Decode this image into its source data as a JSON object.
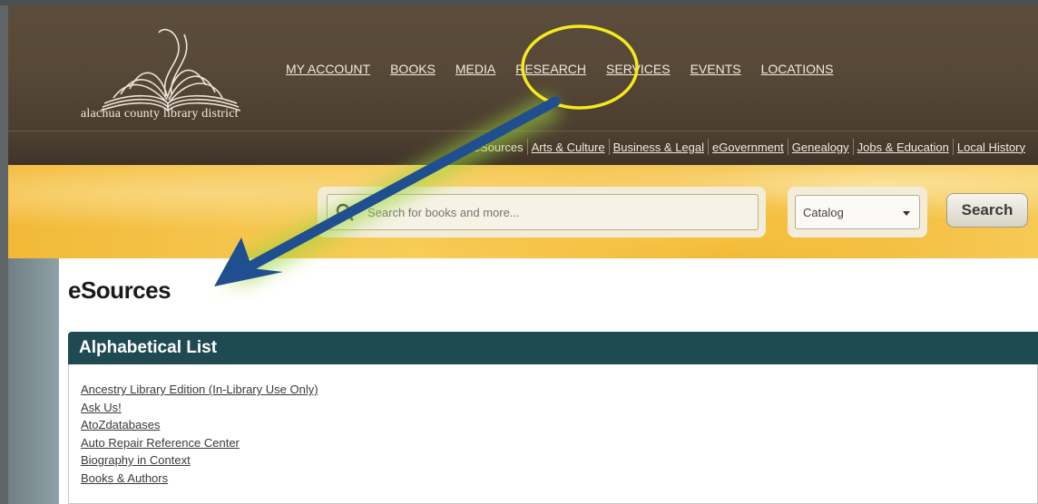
{
  "brand": {
    "logo_text": "alachua county library district"
  },
  "main_nav": [
    {
      "label": "MY ACCOUNT"
    },
    {
      "label": "BOOKS"
    },
    {
      "label": "MEDIA"
    },
    {
      "label": "RESEARCH"
    },
    {
      "label": "SERVICES"
    },
    {
      "label": "EVENTS"
    },
    {
      "label": "LOCATIONS"
    }
  ],
  "sub_nav": [
    {
      "label": "eSources"
    },
    {
      "label": "Arts & Culture"
    },
    {
      "label": "Business & Legal"
    },
    {
      "label": "eGovernment"
    },
    {
      "label": "Genealogy"
    },
    {
      "label": "Jobs & Education"
    },
    {
      "label": "Local History"
    }
  ],
  "search": {
    "placeholder": "Search for books and more...",
    "scope": "Catalog",
    "button_label": "Search"
  },
  "page": {
    "title": "eSources"
  },
  "list": {
    "header": "Alphabetical List",
    "items": [
      "Ancestry Library Edition (In-Library Use Only)",
      "Ask Us!",
      "AtoZdatabases",
      "Auto Repair Reference Center",
      "Biography in Context",
      "Books & Authors"
    ]
  },
  "annotation": {
    "highlight_color": "#f4ea1c",
    "arrow_color": "#1f4f8f",
    "glow_color": "#9dd63a"
  }
}
